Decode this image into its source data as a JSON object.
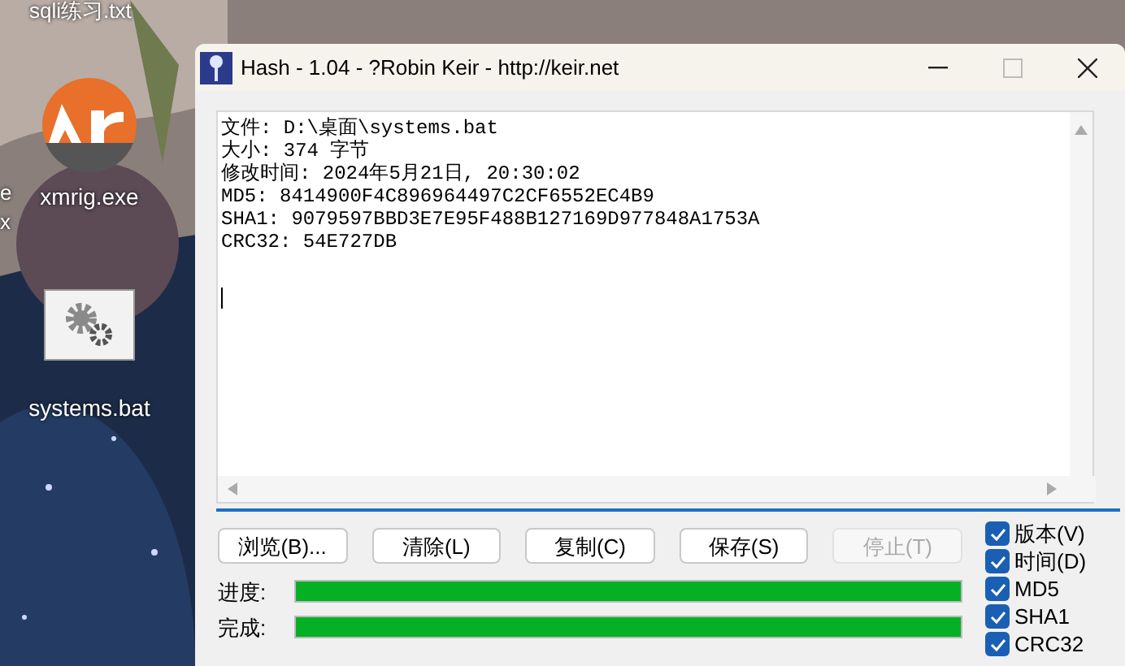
{
  "desktop": {
    "top_label": "sqli练习.txt",
    "cut_label_lines": [
      "e",
      "x"
    ],
    "icons": [
      {
        "kind": "xr",
        "label": "xmrig.exe"
      },
      {
        "kind": "bat",
        "label": "systems.bat"
      }
    ]
  },
  "window": {
    "title": "Hash - 1.04 - ?Robin Keir - http://keir.net",
    "output_lines": [
      "文件: D:\\桌面\\systems.bat",
      "大小: 374 字节",
      "修改时间: 2024年5月21日, 20:30:02",
      "MD5: 8414900F4C896964497C2CF6552EC4B9",
      "SHA1: 9079597BBD3E7E95F488B127169D977848A1753A",
      "CRC32: 54E727DB"
    ],
    "buttons": [
      {
        "label": "浏览(B)...",
        "disabled": false
      },
      {
        "label": "清除(L)",
        "disabled": false
      },
      {
        "label": "复制(C)",
        "disabled": false
      },
      {
        "label": "保存(S)",
        "disabled": false
      },
      {
        "label": "停止(T)",
        "disabled": true
      }
    ],
    "progress": [
      {
        "label": "进度:",
        "level": 1
      },
      {
        "label": "完成:",
        "level": 1
      }
    ],
    "options": [
      {
        "label": "版本(V)",
        "checked": true
      },
      {
        "label": "时间(D)",
        "checked": true
      },
      {
        "label": "MD5",
        "checked": true
      },
      {
        "label": "SHA1",
        "checked": true
      },
      {
        "label": "CRC32",
        "checked": true
      }
    ]
  }
}
